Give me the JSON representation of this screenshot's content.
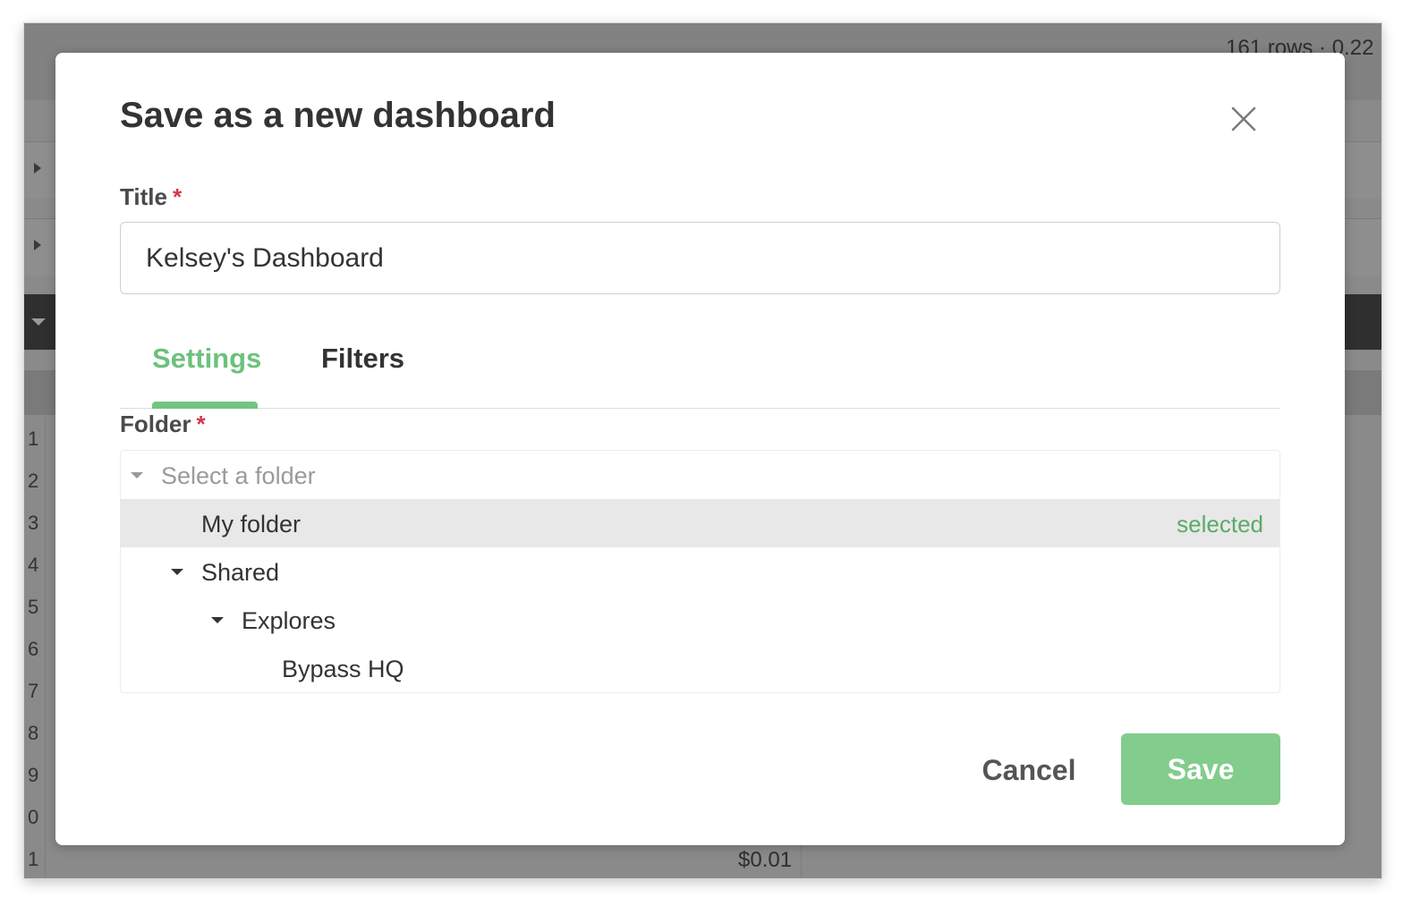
{
  "background": {
    "row_count_text": "161 rows · 0.22",
    "row_numbers": [
      "1",
      "2",
      "3",
      "4",
      "5",
      "6",
      "7",
      "8",
      "9",
      "0",
      "1"
    ],
    "visible_cell_value": "$0.01"
  },
  "modal": {
    "title": "Save as a new dashboard",
    "title_field": {
      "label": "Title",
      "required_marker": "*",
      "value": "Kelsey's Dashboard"
    },
    "tabs": [
      {
        "label": "Settings",
        "active": true
      },
      {
        "label": "Filters",
        "active": false
      }
    ],
    "folder_field": {
      "label": "Folder",
      "required_marker": "*",
      "placeholder": "Select a folder",
      "items": [
        {
          "label": "My folder",
          "depth": 1,
          "selected": true,
          "status": "selected"
        },
        {
          "label": "Shared",
          "depth": 1,
          "expanded": true
        },
        {
          "label": "Explores",
          "depth": 2,
          "expanded": true
        },
        {
          "label": "Bypass HQ",
          "depth": 3
        }
      ]
    },
    "buttons": {
      "cancel": "Cancel",
      "save": "Save"
    }
  },
  "colors": {
    "accent_green": "#6cc17b",
    "save_button": "#82cc8c",
    "required_red": "#d0394b"
  }
}
